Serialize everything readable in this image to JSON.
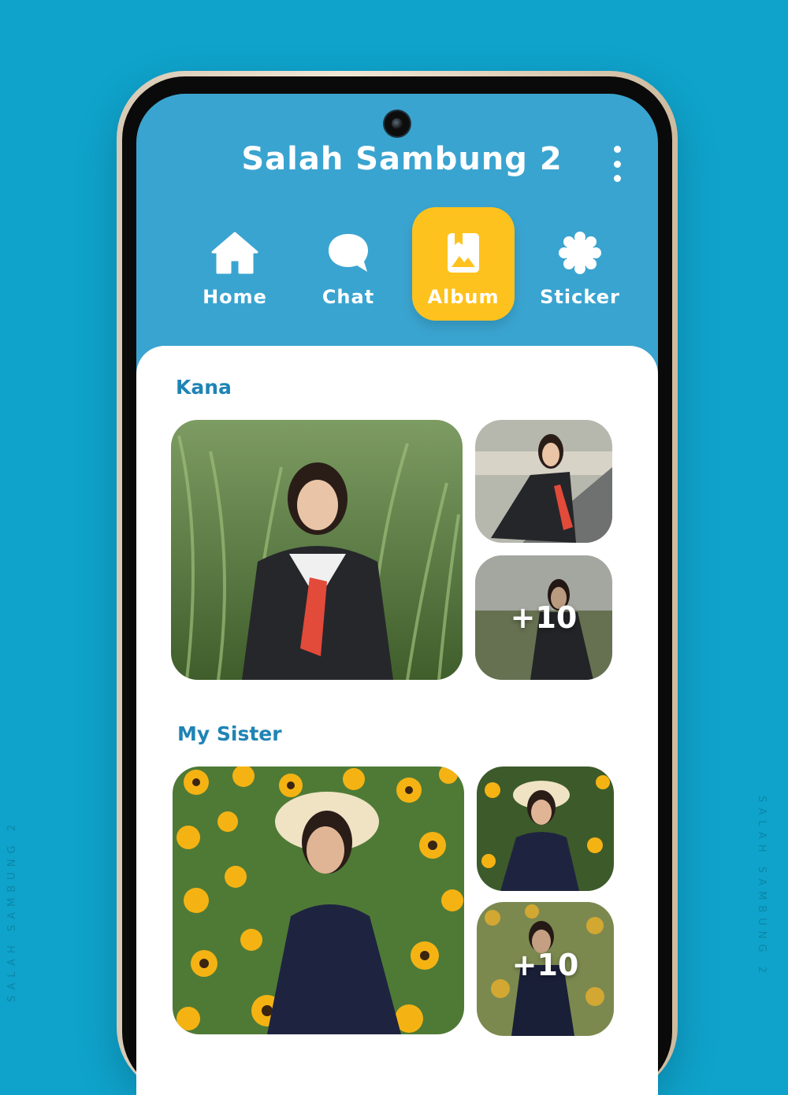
{
  "app": {
    "title": "Salah Sambung 2",
    "menu_icon": "more-vertical-icon"
  },
  "side_text": {
    "left": "SALAH SAMBUNG 2",
    "right": "SALAH SAMBUNG 2"
  },
  "tabs": [
    {
      "label": "Home",
      "icon": "home-icon",
      "active": false
    },
    {
      "label": "Chat",
      "icon": "chat-bubble-icon",
      "active": false
    },
    {
      "label": "Album",
      "icon": "album-icon",
      "active": true
    },
    {
      "label": "Sticker",
      "icon": "sticker-flower-icon",
      "active": false
    }
  ],
  "albums": [
    {
      "title": "Kana",
      "more_count": "+10"
    },
    {
      "title": "My Sister",
      "more_count": "+10"
    }
  ],
  "colors": {
    "background": "#0fa3cb",
    "header": "#3aa4d0",
    "accent": "#fdc21d",
    "album_title": "#1f84b5"
  }
}
